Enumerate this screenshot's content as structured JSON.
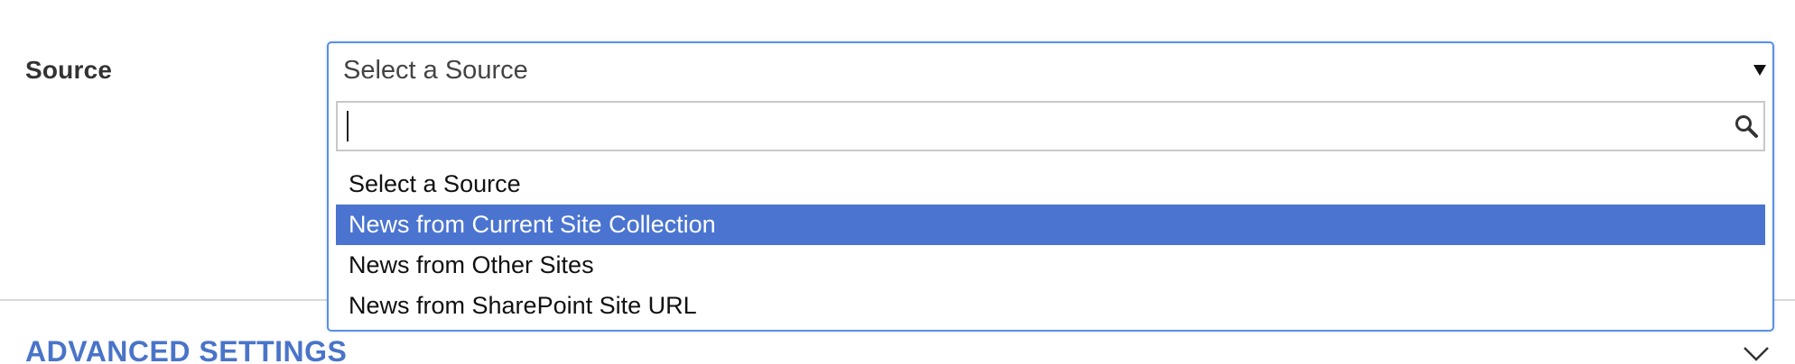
{
  "form": {
    "source_label": "Source"
  },
  "select": {
    "selected_value": "Select a Source",
    "arrow_icon": "triangle-down-icon",
    "search": {
      "value": "",
      "placeholder": "",
      "icon": "search-icon"
    },
    "options": [
      {
        "label": "Select a Source",
        "highlighted": false
      },
      {
        "label": "News from Current Site Collection",
        "highlighted": true
      },
      {
        "label": "News from Other Sites",
        "highlighted": false
      },
      {
        "label": "News from SharePoint Site URL",
        "highlighted": false
      }
    ]
  },
  "advanced": {
    "title": "ADVANCED SETTINGS",
    "icon": "chevron-down-icon"
  },
  "colors": {
    "accent": "#4a74cf",
    "focus_border": "#5b8fe3",
    "heading_blue": "#4a74c9"
  }
}
